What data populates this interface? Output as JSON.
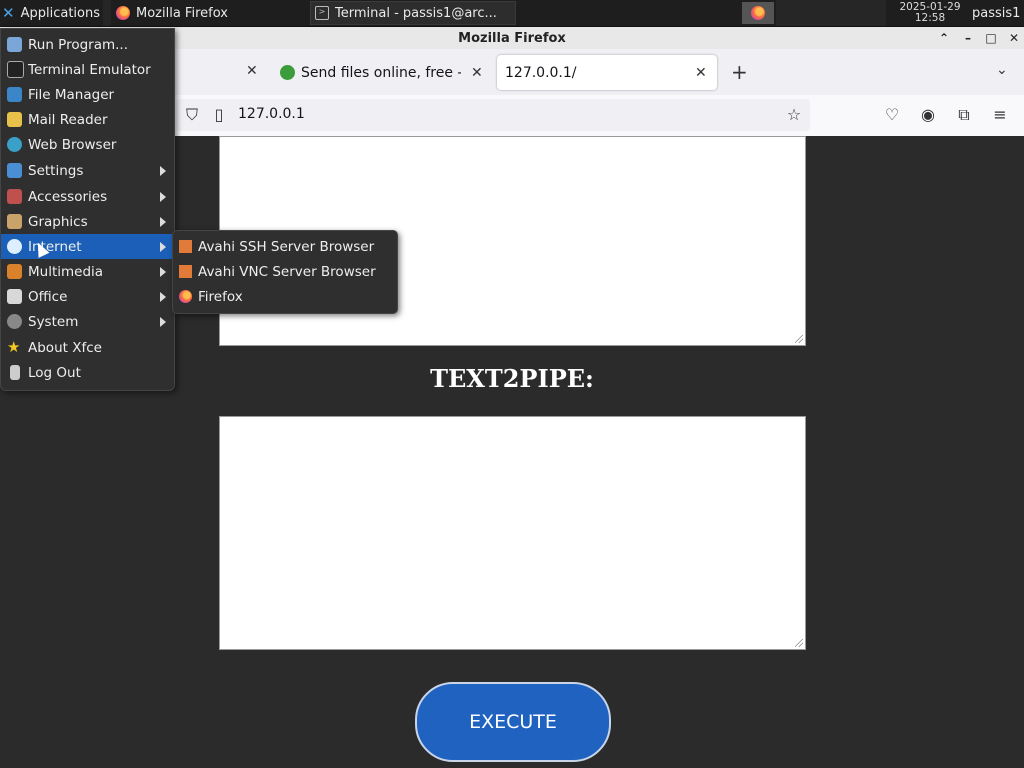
{
  "panel": {
    "applications_label": "Applications",
    "tasks": [
      {
        "label": "Mozilla Firefox"
      },
      {
        "label": "Terminal - passis1@arc..."
      }
    ],
    "clock_date": "2025-01-29",
    "clock_time": "12:58",
    "user": "passis1"
  },
  "window": {
    "title": "Mozilla Firefox",
    "tabs": [
      {
        "label": "Send files online, free - T"
      },
      {
        "label": "127.0.0.1/"
      }
    ],
    "url": "127.0.0.1"
  },
  "page": {
    "heading": "TEXT2PIPE:",
    "execute_label": "EXECUTE"
  },
  "app_menu": {
    "items": [
      {
        "label": "Run Program...",
        "icon": "run-icon"
      },
      {
        "label": "Terminal Emulator",
        "icon": "terminal-icon"
      },
      {
        "label": "File Manager",
        "icon": "file-manager-icon"
      },
      {
        "label": "Mail Reader",
        "icon": "mail-icon"
      },
      {
        "label": "Web Browser",
        "icon": "web-browser-icon"
      },
      {
        "label": "Settings",
        "icon": "settings-icon"
      },
      {
        "label": "Accessories",
        "icon": "accessories-icon"
      },
      {
        "label": "Graphics",
        "icon": "graphics-icon"
      },
      {
        "label": "Internet",
        "icon": "internet-icon"
      },
      {
        "label": "Multimedia",
        "icon": "multimedia-icon"
      },
      {
        "label": "Office",
        "icon": "office-icon"
      },
      {
        "label": "System",
        "icon": "system-icon"
      },
      {
        "label": "About Xfce",
        "icon": "star-icon"
      },
      {
        "label": "Log Out",
        "icon": "logout-icon"
      }
    ],
    "highlight_color": "#1c5fb8"
  },
  "submenu": {
    "items": [
      {
        "label": "Avahi SSH Server Browser",
        "icon": "avahi-icon"
      },
      {
        "label": "Avahi VNC Server Browser",
        "icon": "avahi-icon"
      },
      {
        "label": "Firefox",
        "icon": "firefox-icon"
      }
    ]
  }
}
